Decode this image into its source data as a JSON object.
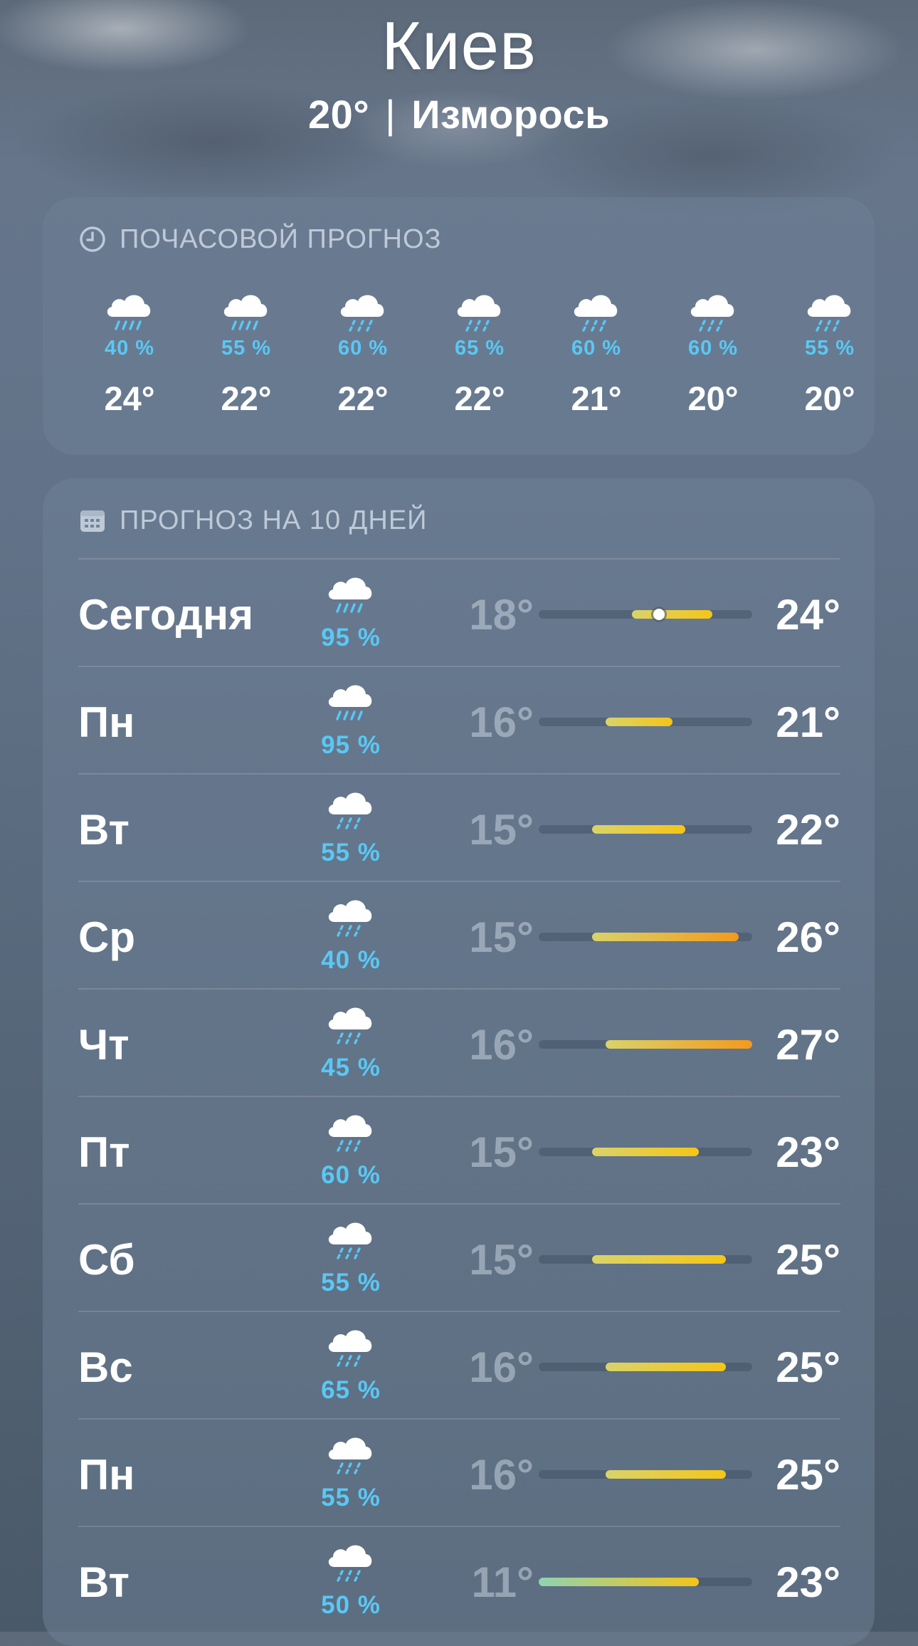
{
  "header": {
    "city": "Киев",
    "temp": "20°",
    "condition": "Изморось"
  },
  "hourly": {
    "title": "ПОЧАСОВОЙ ПРОГНОЗ",
    "items": [
      {
        "pct": "40 %",
        "temp": "24°",
        "icon": "cloud-rain-icon"
      },
      {
        "pct": "55 %",
        "temp": "22°",
        "icon": "cloud-rain-icon"
      },
      {
        "pct": "60 %",
        "temp": "22°",
        "icon": "cloud-drizzle-icon"
      },
      {
        "pct": "65 %",
        "temp": "22°",
        "icon": "cloud-drizzle-icon"
      },
      {
        "pct": "60 %",
        "temp": "21°",
        "icon": "cloud-drizzle-icon"
      },
      {
        "pct": "60 %",
        "temp": "20°",
        "icon": "cloud-drizzle-icon"
      },
      {
        "pct": "55 %",
        "temp": "20°",
        "icon": "cloud-drizzle-icon"
      }
    ]
  },
  "daily": {
    "title": "ПРОГНОЗ НА 10 ДНЕЙ",
    "range": [
      11,
      27
    ],
    "current_temp": 20,
    "days": [
      {
        "day": "Сегодня",
        "pct": "95 %",
        "lo": "18°",
        "hi": "24°",
        "lo_val": 18,
        "hi_val": 24,
        "icon": "cloud-rain-icon"
      },
      {
        "day": "Пн",
        "pct": "95 %",
        "lo": "16°",
        "hi": "21°",
        "lo_val": 16,
        "hi_val": 21,
        "icon": "cloud-rain-icon"
      },
      {
        "day": "Вт",
        "pct": "55 %",
        "lo": "15°",
        "hi": "22°",
        "lo_val": 15,
        "hi_val": 22,
        "icon": "cloud-drizzle-icon"
      },
      {
        "day": "Ср",
        "pct": "40 %",
        "lo": "15°",
        "hi": "26°",
        "lo_val": 15,
        "hi_val": 26,
        "icon": "cloud-drizzle-icon"
      },
      {
        "day": "Чт",
        "pct": "45 %",
        "lo": "16°",
        "hi": "27°",
        "lo_val": 16,
        "hi_val": 27,
        "icon": "cloud-drizzle-icon"
      },
      {
        "day": "Пт",
        "pct": "60 %",
        "lo": "15°",
        "hi": "23°",
        "lo_val": 15,
        "hi_val": 23,
        "icon": "cloud-drizzle-icon"
      },
      {
        "day": "Сб",
        "pct": "55 %",
        "lo": "15°",
        "hi": "25°",
        "lo_val": 15,
        "hi_val": 25,
        "icon": "cloud-drizzle-icon"
      },
      {
        "day": "Вс",
        "pct": "65 %",
        "lo": "16°",
        "hi": "25°",
        "lo_val": 16,
        "hi_val": 25,
        "icon": "cloud-drizzle-icon"
      },
      {
        "day": "Пн",
        "pct": "55 %",
        "lo": "16°",
        "hi": "25°",
        "lo_val": 16,
        "hi_val": 25,
        "icon": "cloud-drizzle-icon"
      },
      {
        "day": "Вт",
        "pct": "50 %",
        "lo": "11°",
        "hi": "23°",
        "lo_val": 11,
        "hi_val": 23,
        "icon": "cloud-drizzle-icon"
      }
    ]
  },
  "colors": {
    "precip": "#59c8f5",
    "cool": "#8fd3b0",
    "mild": "#d9d36a",
    "warm": "#f5c518",
    "hot": "#f39a1c"
  }
}
